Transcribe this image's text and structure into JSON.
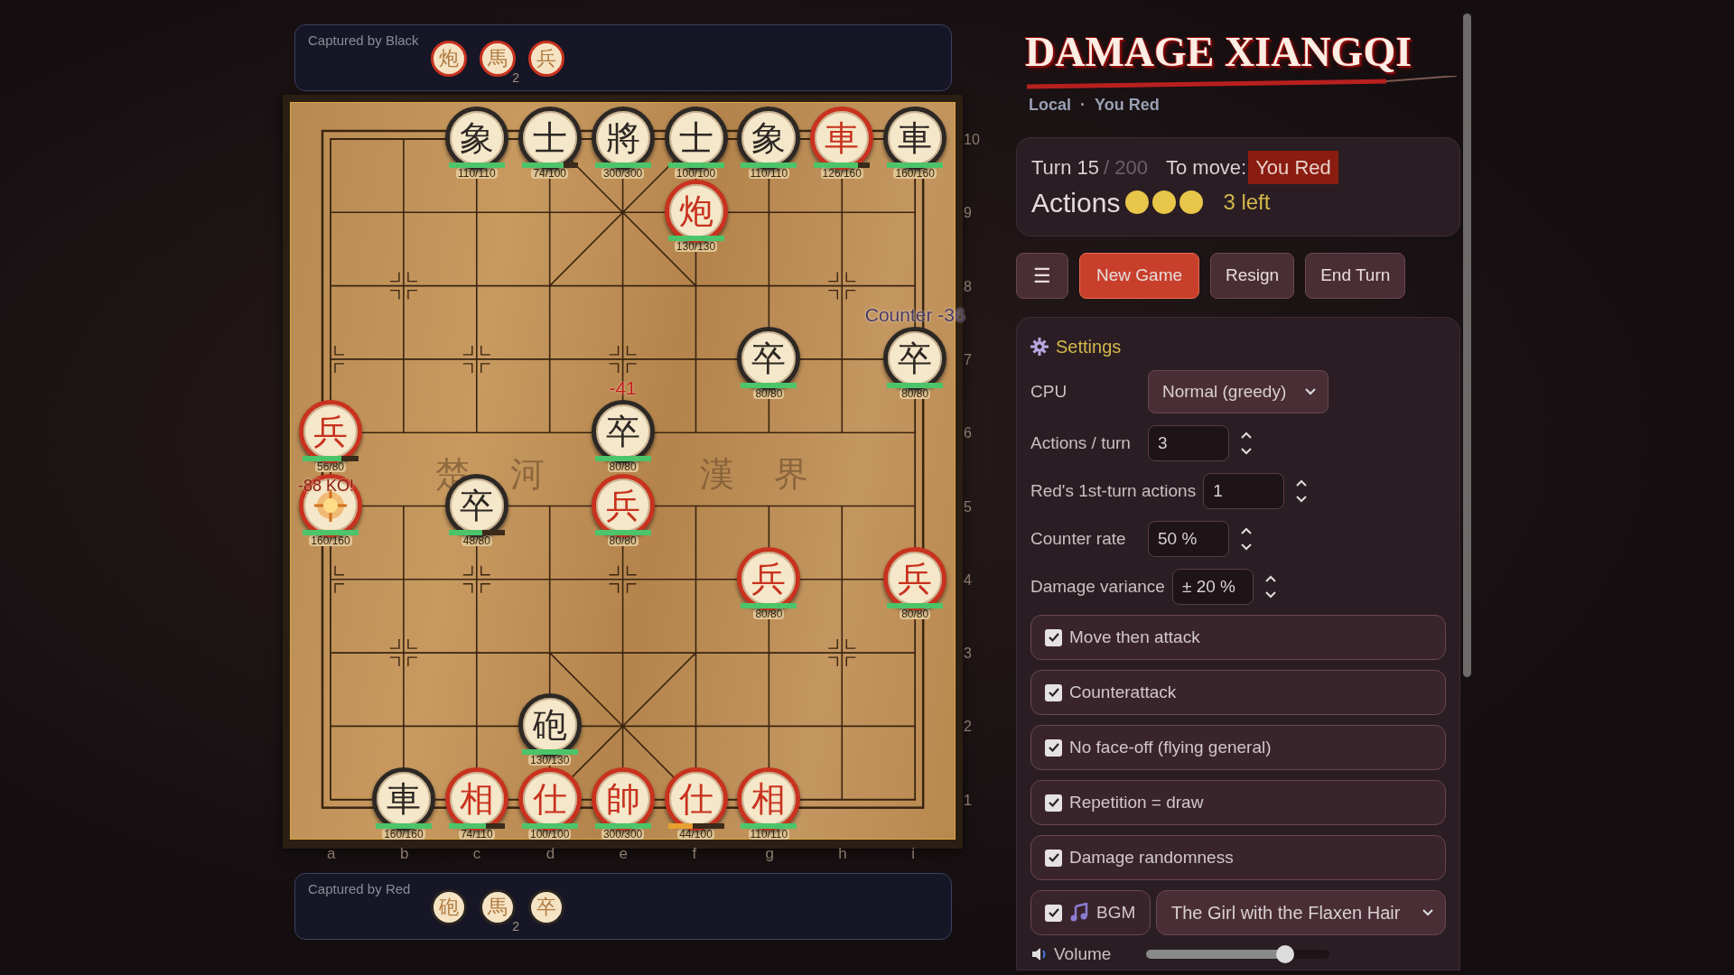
{
  "captured_by_black": {
    "label": "Captured by Black",
    "pieces": [
      {
        "char": "炮",
        "color": "#c8321f"
      },
      {
        "char": "馬",
        "color": "#c8321f",
        "count": "2"
      },
      {
        "char": "兵",
        "color": "#c8321f"
      }
    ]
  },
  "board": {
    "files": [
      "a",
      "b",
      "c",
      "d",
      "e",
      "f",
      "g",
      "h",
      "i"
    ],
    "river": [
      "楚",
      "河",
      "漢",
      "界"
    ],
    "rows": [
      {
        "rank": "10",
        "cells": [
          {
            "kind": "empty"
          },
          {
            "kind": "empty"
          },
          {
            "kind": "piece",
            "char": "象",
            "color": "#2d2824",
            "hp": "110/110",
            "level": 1
          },
          {
            "kind": "piece",
            "char": "士",
            "color": "#2d2824",
            "hp": "74/100",
            "level": 0.74
          },
          {
            "kind": "piece",
            "char": "將",
            "color": "#2d2824",
            "hp": "300/300",
            "level": 1
          },
          {
            "kind": "piece",
            "char": "士",
            "color": "#2d2824",
            "hp": "100/100",
            "level": 1
          },
          {
            "kind": "piece",
            "char": "象",
            "color": "#2d2824",
            "hp": "110/110",
            "level": 1
          },
          {
            "kind": "piece",
            "char": "車",
            "color": "#c8321f",
            "hp": "126/160",
            "level": 0.79
          },
          {
            "kind": "piece",
            "char": "車",
            "color": "#2d2824",
            "hp": "160/160",
            "level": 1
          }
        ]
      },
      {
        "rank": "9",
        "cells": [
          {
            "kind": "empty"
          },
          {
            "kind": "empty"
          },
          {
            "kind": "empty"
          },
          {
            "kind": "empty"
          },
          {
            "kind": "empty"
          },
          {
            "kind": "piece",
            "char": "炮",
            "color": "#c8321f",
            "hp": "130/130",
            "level": 1
          },
          {
            "kind": "empty"
          },
          {
            "kind": "empty"
          },
          {
            "kind": "empty"
          }
        ]
      },
      {
        "rank": "8",
        "cells": [
          {
            "kind": "empty"
          },
          {
            "kind": "empty"
          },
          {
            "kind": "empty"
          },
          {
            "kind": "empty"
          },
          {
            "kind": "empty"
          },
          {
            "kind": "empty"
          },
          {
            "kind": "empty"
          },
          {
            "kind": "empty"
          },
          {
            "kind": "empty"
          }
        ]
      },
      {
        "rank": "7",
        "cells": [
          {
            "kind": "empty"
          },
          {
            "kind": "empty"
          },
          {
            "kind": "empty"
          },
          {
            "kind": "empty"
          },
          {
            "kind": "empty"
          },
          {
            "kind": "empty"
          },
          {
            "kind": "piece",
            "char": "卒",
            "color": "#2d2824",
            "hp": "80/80",
            "level": 1
          },
          {
            "kind": "empty"
          },
          {
            "kind": "piece",
            "char": "卒",
            "color": "#2d2824",
            "hp": "80/80",
            "level": 1,
            "popup": {
              "text": "Counter -36",
              "kind": "counter"
            }
          }
        ]
      },
      {
        "rank": "6",
        "cells": [
          {
            "kind": "piece",
            "char": "兵",
            "color": "#c8321f",
            "hp": "56/80",
            "level": 0.7
          },
          {
            "kind": "empty"
          },
          {
            "kind": "empty"
          },
          {
            "kind": "empty"
          },
          {
            "kind": "piece",
            "char": "卒",
            "color": "#2d2824",
            "hp": "80/80",
            "level": 1,
            "popup": {
              "text": "-41",
              "kind": "damage"
            }
          },
          {
            "kind": "empty"
          },
          {
            "kind": "empty"
          },
          {
            "kind": "empty"
          },
          {
            "kind": "empty"
          }
        ]
      },
      {
        "rank": "5",
        "cells": [
          {
            "kind": "piece",
            "color": "#c8321f",
            "hp": "160/160",
            "level": 1,
            "ko": true,
            "popup": {
              "text": "-88 KO!",
              "kind": "ko"
            }
          },
          {
            "kind": "empty"
          },
          {
            "kind": "piece",
            "char": "卒",
            "color": "#2d2824",
            "hp": "48/80",
            "level": 0.6
          },
          {
            "kind": "empty"
          },
          {
            "kind": "piece",
            "char": "兵",
            "color": "#c8321f",
            "hp": "80/80",
            "level": 1
          },
          {
            "kind": "empty"
          },
          {
            "kind": "empty"
          },
          {
            "kind": "empty"
          },
          {
            "kind": "empty"
          }
        ]
      },
      {
        "rank": "4",
        "cells": [
          {
            "kind": "empty"
          },
          {
            "kind": "empty"
          },
          {
            "kind": "empty"
          },
          {
            "kind": "empty"
          },
          {
            "kind": "empty"
          },
          {
            "kind": "empty"
          },
          {
            "kind": "piece",
            "char": "兵",
            "color": "#c8321f",
            "hp": "80/80",
            "level": 1
          },
          {
            "kind": "empty"
          },
          {
            "kind": "piece",
            "char": "兵",
            "color": "#c8321f",
            "hp": "80/80",
            "level": 1
          }
        ]
      },
      {
        "rank": "3",
        "cells": [
          {
            "kind": "empty"
          },
          {
            "kind": "empty"
          },
          {
            "kind": "empty"
          },
          {
            "kind": "empty"
          },
          {
            "kind": "empty"
          },
          {
            "kind": "empty"
          },
          {
            "kind": "empty"
          },
          {
            "kind": "empty"
          },
          {
            "kind": "empty"
          }
        ]
      },
      {
        "rank": "2",
        "cells": [
          {
            "kind": "empty"
          },
          {
            "kind": "empty"
          },
          {
            "kind": "empty"
          },
          {
            "kind": "piece",
            "char": "砲",
            "color": "#2d2824",
            "hp": "130/130",
            "level": 1
          },
          {
            "kind": "empty"
          },
          {
            "kind": "empty"
          },
          {
            "kind": "empty"
          },
          {
            "kind": "empty"
          },
          {
            "kind": "empty"
          }
        ]
      },
      {
        "rank": "1",
        "cells": [
          {
            "kind": "empty"
          },
          {
            "kind": "piece",
            "char": "車",
            "color": "#2d2824",
            "hp": "160/160",
            "level": 1
          },
          {
            "kind": "piece",
            "char": "相",
            "color": "#c8321f",
            "hp": "74/110",
            "level": 0.67
          },
          {
            "kind": "piece",
            "char": "仕",
            "color": "#c8321f",
            "hp": "100/100",
            "level": 1
          },
          {
            "kind": "piece",
            "char": "帥",
            "color": "#c8321f",
            "hp": "300/300",
            "level": 1
          },
          {
            "kind": "piece",
            "char": "仕",
            "color": "#c8321f",
            "hp": "44/100",
            "level": 0.44
          },
          {
            "kind": "piece",
            "char": "相",
            "color": "#c8321f",
            "hp": "110/110",
            "level": 1
          },
          {
            "kind": "empty"
          },
          {
            "kind": "empty"
          }
        ]
      }
    ]
  },
  "captured_by_red": {
    "label": "Captured by Red",
    "pieces": [
      {
        "char": "砲",
        "color": "#2a2420"
      },
      {
        "char": "馬",
        "color": "#2a2420",
        "count": "2"
      },
      {
        "char": "卒",
        "color": "#2a2420"
      }
    ]
  },
  "title": "DAMAGE XIANGQI",
  "subtitle": {
    "mode": "Local",
    "separator": "·",
    "player": "You Red"
  },
  "status": {
    "turn": "Turn 15",
    "turn_limit": "/ 200",
    "to_move_label": "To move:",
    "to_move": "You Red",
    "actions_label": "Actions",
    "pips": [
      {
        "used": false
      },
      {
        "used": false
      },
      {
        "used": false
      }
    ],
    "remaining": "3 left"
  },
  "buttons": [
    {
      "kind": "menu",
      "label": "☰"
    },
    {
      "kind": "primary",
      "label": "New Game"
    },
    {
      "kind": "normal",
      "label": "Resign"
    },
    {
      "kind": "normal",
      "label": "End Turn"
    }
  ],
  "settings": {
    "title": "Settings",
    "items": [
      {
        "kind": "select",
        "label": "CPU",
        "value": "Normal (greedy)"
      },
      {
        "kind": "number",
        "label": "Actions / turn",
        "value": "3"
      },
      {
        "kind": "number",
        "label": "Red's 1st-turn actions",
        "value": "1"
      },
      {
        "kind": "number",
        "label": "Counter rate",
        "value": "50 %"
      },
      {
        "kind": "number",
        "label": "Damage variance",
        "value": "± 20 %"
      },
      {
        "kind": "checkbox",
        "label": "Move then attack",
        "checked": true
      },
      {
        "kind": "checkbox",
        "label": "Counterattack",
        "checked": true
      },
      {
        "kind": "checkbox",
        "label": "No face-off (flying general)",
        "checked": true
      },
      {
        "kind": "checkbox",
        "label": "Repetition = draw",
        "checked": true
      },
      {
        "kind": "checkbox",
        "label": "Damage randomness",
        "checked": true
      },
      {
        "kind": "bgm",
        "label": "BGM",
        "checked": true,
        "value": "The Girl with the Flaxen Hair"
      },
      {
        "kind": "slider",
        "label": "Volume",
        "level": 0.76
      }
    ]
  }
}
